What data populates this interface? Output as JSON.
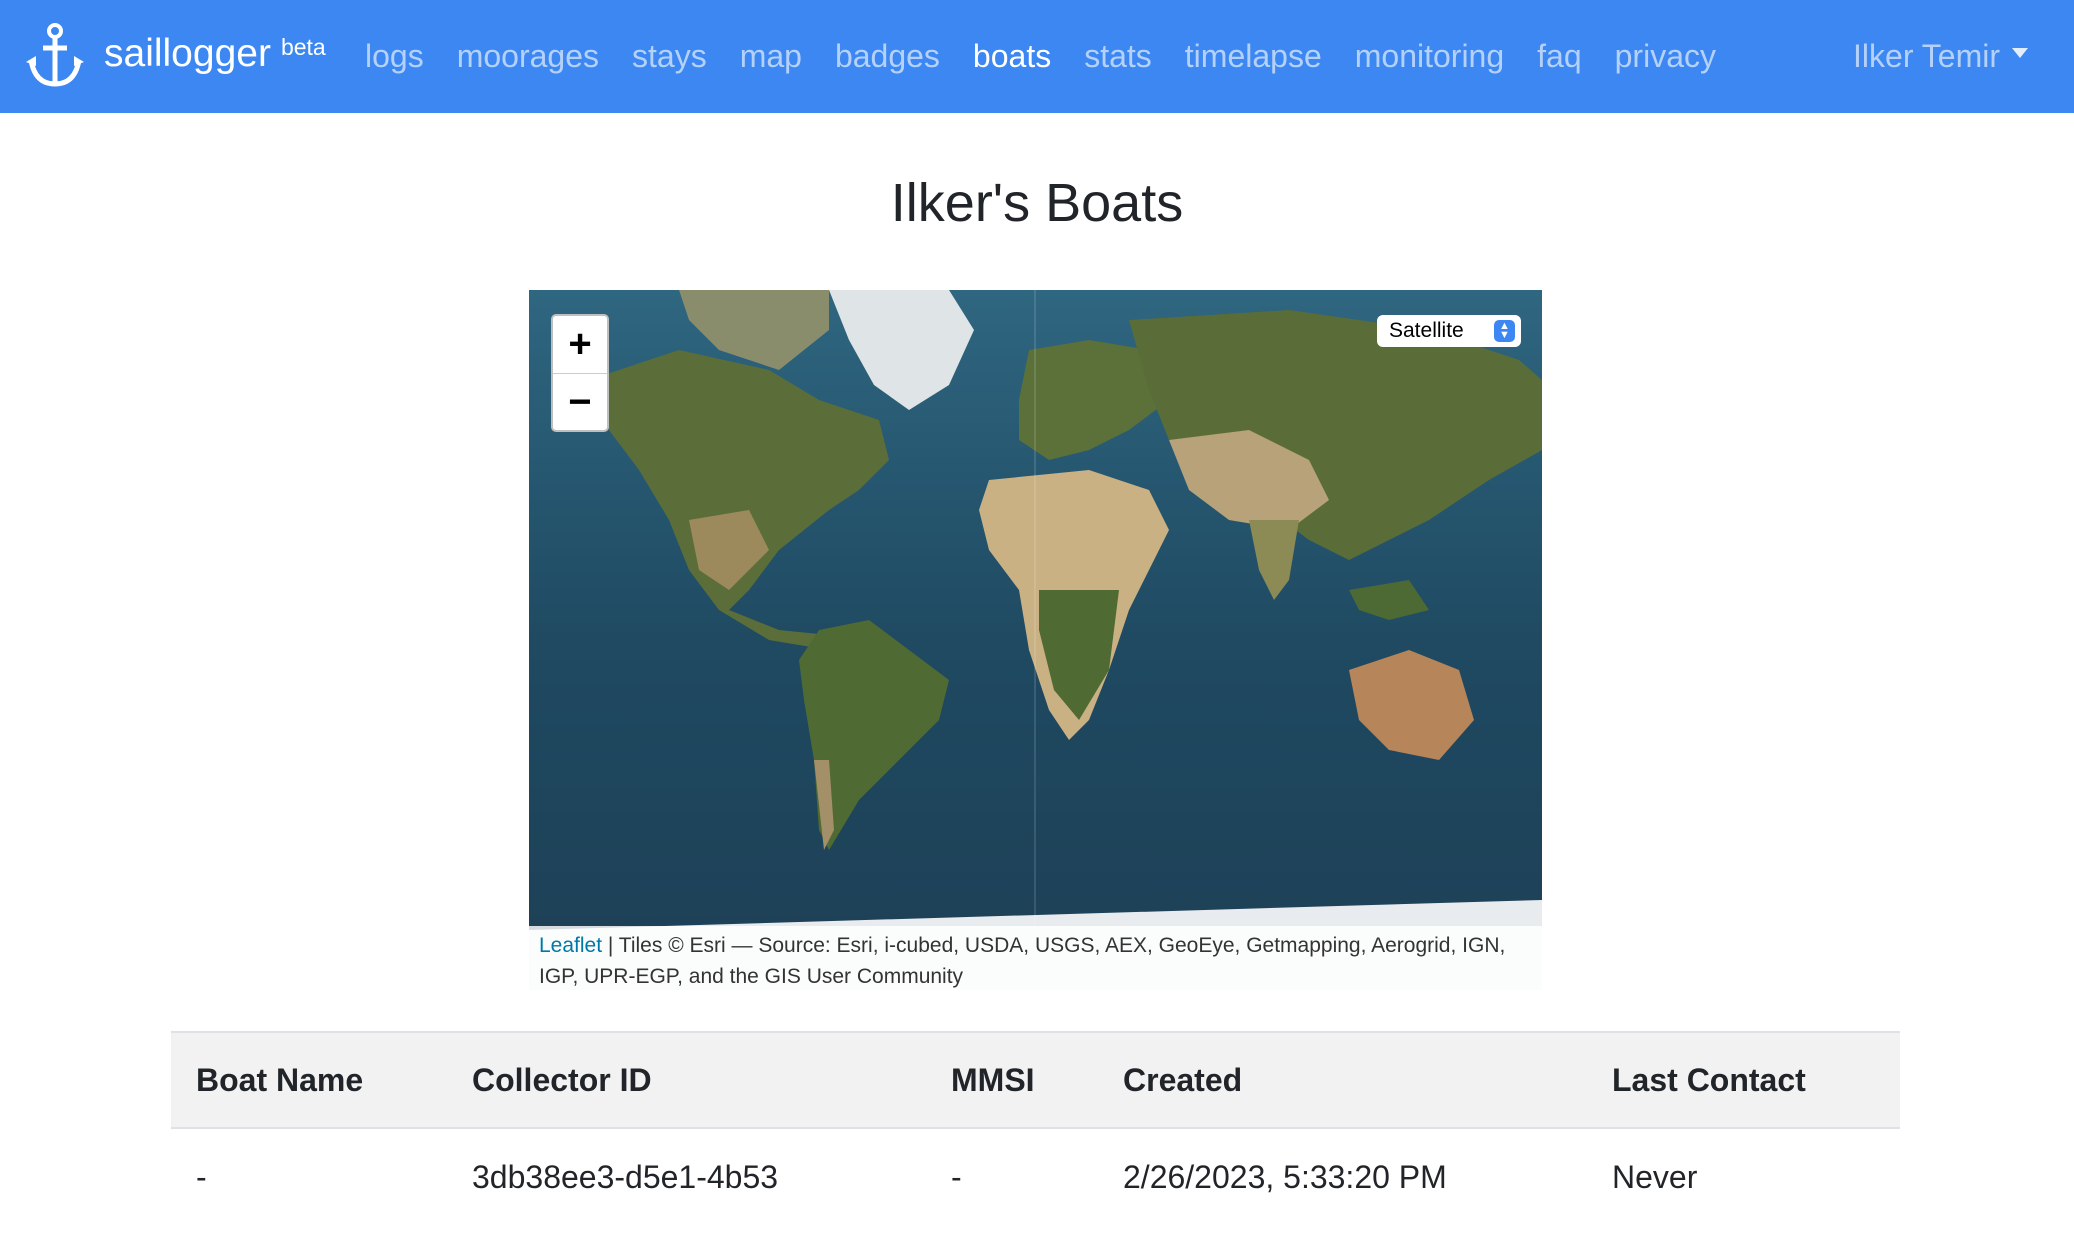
{
  "navbar": {
    "brand": "saillogger",
    "beta": "beta",
    "links": [
      {
        "label": "logs",
        "active": false
      },
      {
        "label": "moorages",
        "active": false
      },
      {
        "label": "stays",
        "active": false
      },
      {
        "label": "map",
        "active": false
      },
      {
        "label": "badges",
        "active": false
      },
      {
        "label": "boats",
        "active": true
      },
      {
        "label": "stats",
        "active": false
      },
      {
        "label": "timelapse",
        "active": false
      },
      {
        "label": "monitoring",
        "active": false
      },
      {
        "label": "faq",
        "active": false
      },
      {
        "label": "privacy",
        "active": false
      }
    ],
    "user": "Ilker Temir",
    "brand_color": "#3c87f1"
  },
  "page": {
    "title": "Ilker's Boats"
  },
  "map": {
    "zoom_in": "+",
    "zoom_out": "−",
    "layer_selected": "Satellite",
    "attribution_link": "Leaflet",
    "attribution_text": " | Tiles © Esri — Source: Esri, i-cubed, USDA, USGS, AEX, GeoEye, Getmapping, Aerogrid, IGN, IGP, UPR-EGP, and the GIS User Community"
  },
  "table": {
    "headers": [
      "Boat Name",
      "Collector ID",
      "MMSI",
      "Created",
      "Last Contact"
    ],
    "rows": [
      [
        "-",
        "3db38ee3-d5e1-4b53",
        "-",
        "2/26/2023, 5:33:20 PM",
        "Never"
      ]
    ]
  }
}
